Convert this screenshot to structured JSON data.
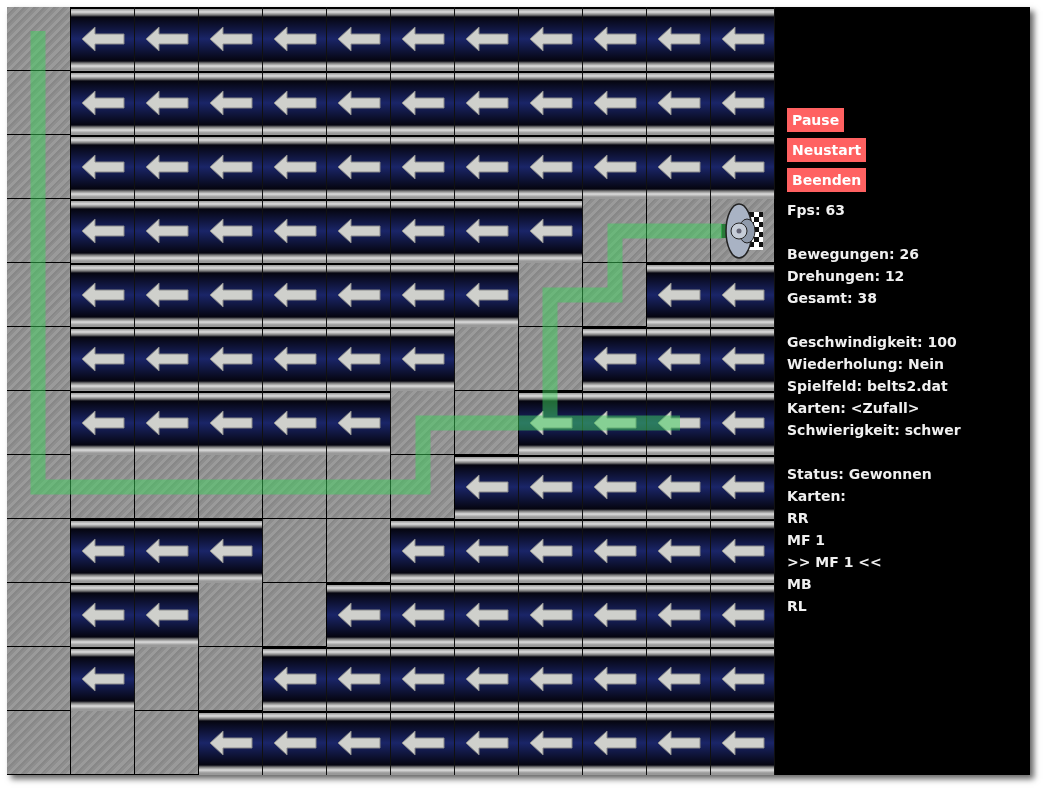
{
  "board": {
    "rows": [
      {
        "cells": [
          {
            "kind": "floor"
          },
          {
            "kind": "belt"
          },
          {
            "kind": "belt"
          },
          {
            "kind": "belt"
          },
          {
            "kind": "belt"
          },
          {
            "kind": "belt"
          },
          {
            "kind": "belt"
          },
          {
            "kind": "belt"
          },
          {
            "kind": "belt"
          },
          {
            "kind": "belt"
          },
          {
            "kind": "belt"
          },
          {
            "kind": "belt"
          }
        ]
      },
      {
        "cells": [
          {
            "kind": "floor"
          },
          {
            "kind": "belt"
          },
          {
            "kind": "belt"
          },
          {
            "kind": "belt"
          },
          {
            "kind": "belt"
          },
          {
            "kind": "belt"
          },
          {
            "kind": "belt"
          },
          {
            "kind": "belt"
          },
          {
            "kind": "belt"
          },
          {
            "kind": "belt"
          },
          {
            "kind": "belt"
          },
          {
            "kind": "belt"
          }
        ]
      },
      {
        "cells": [
          {
            "kind": "floor"
          },
          {
            "kind": "belt"
          },
          {
            "kind": "belt"
          },
          {
            "kind": "belt"
          },
          {
            "kind": "belt"
          },
          {
            "kind": "belt"
          },
          {
            "kind": "belt"
          },
          {
            "kind": "belt"
          },
          {
            "kind": "belt"
          },
          {
            "kind": "belt"
          },
          {
            "kind": "belt"
          },
          {
            "kind": "belt"
          }
        ]
      },
      {
        "cells": [
          {
            "kind": "floor"
          },
          {
            "kind": "belt"
          },
          {
            "kind": "belt"
          },
          {
            "kind": "belt"
          },
          {
            "kind": "belt"
          },
          {
            "kind": "belt"
          },
          {
            "kind": "belt"
          },
          {
            "kind": "belt"
          },
          {
            "kind": "belt"
          },
          {
            "kind": "floor"
          },
          {
            "kind": "floor"
          },
          {
            "kind": "robot"
          }
        ]
      },
      {
        "cells": [
          {
            "kind": "floor"
          },
          {
            "kind": "belt"
          },
          {
            "kind": "belt"
          },
          {
            "kind": "belt"
          },
          {
            "kind": "belt"
          },
          {
            "kind": "belt"
          },
          {
            "kind": "belt"
          },
          {
            "kind": "belt"
          },
          {
            "kind": "floor"
          },
          {
            "kind": "floor"
          },
          {
            "kind": "belt"
          },
          {
            "kind": "belt"
          }
        ]
      },
      {
        "cells": [
          {
            "kind": "floor"
          },
          {
            "kind": "belt"
          },
          {
            "kind": "belt"
          },
          {
            "kind": "belt"
          },
          {
            "kind": "belt"
          },
          {
            "kind": "belt"
          },
          {
            "kind": "belt"
          },
          {
            "kind": "floor"
          },
          {
            "kind": "floor"
          },
          {
            "kind": "belt"
          },
          {
            "kind": "belt"
          },
          {
            "kind": "belt"
          }
        ]
      },
      {
        "cells": [
          {
            "kind": "floor"
          },
          {
            "kind": "belt"
          },
          {
            "kind": "belt"
          },
          {
            "kind": "belt"
          },
          {
            "kind": "belt"
          },
          {
            "kind": "belt"
          },
          {
            "kind": "floor"
          },
          {
            "kind": "floor"
          },
          {
            "kind": "belt"
          },
          {
            "kind": "belt"
          },
          {
            "kind": "belt"
          },
          {
            "kind": "belt"
          }
        ]
      },
      {
        "cells": [
          {
            "kind": "floor"
          },
          {
            "kind": "floor"
          },
          {
            "kind": "floor"
          },
          {
            "kind": "floor"
          },
          {
            "kind": "floor"
          },
          {
            "kind": "floor"
          },
          {
            "kind": "floor"
          },
          {
            "kind": "belt"
          },
          {
            "kind": "belt"
          },
          {
            "kind": "belt"
          },
          {
            "kind": "belt"
          },
          {
            "kind": "belt"
          }
        ]
      },
      {
        "cells": [
          {
            "kind": "floor"
          },
          {
            "kind": "belt"
          },
          {
            "kind": "belt"
          },
          {
            "kind": "belt"
          },
          {
            "kind": "floor"
          },
          {
            "kind": "floor"
          },
          {
            "kind": "belt"
          },
          {
            "kind": "belt"
          },
          {
            "kind": "belt"
          },
          {
            "kind": "belt"
          },
          {
            "kind": "belt"
          },
          {
            "kind": "belt"
          }
        ]
      },
      {
        "cells": [
          {
            "kind": "floor"
          },
          {
            "kind": "belt"
          },
          {
            "kind": "belt"
          },
          {
            "kind": "floor"
          },
          {
            "kind": "floor"
          },
          {
            "kind": "belt"
          },
          {
            "kind": "belt"
          },
          {
            "kind": "belt"
          },
          {
            "kind": "belt"
          },
          {
            "kind": "belt"
          },
          {
            "kind": "belt"
          },
          {
            "kind": "belt"
          }
        ]
      },
      {
        "cells": [
          {
            "kind": "floor"
          },
          {
            "kind": "belt"
          },
          {
            "kind": "floor"
          },
          {
            "kind": "floor"
          },
          {
            "kind": "belt"
          },
          {
            "kind": "belt"
          },
          {
            "kind": "belt"
          },
          {
            "kind": "belt"
          },
          {
            "kind": "belt"
          },
          {
            "kind": "belt"
          },
          {
            "kind": "belt"
          },
          {
            "kind": "belt"
          }
        ]
      },
      {
        "cells": [
          {
            "kind": "floor"
          },
          {
            "kind": "floor"
          },
          {
            "kind": "floor"
          },
          {
            "kind": "belt"
          },
          {
            "kind": "belt"
          },
          {
            "kind": "belt"
          },
          {
            "kind": "belt"
          },
          {
            "kind": "belt"
          },
          {
            "kind": "belt"
          },
          {
            "kind": "belt"
          },
          {
            "kind": "belt"
          },
          {
            "kind": "belt"
          }
        ]
      }
    ]
  },
  "buttons": [
    "Pause",
    "Neustart",
    "Beenden"
  ],
  "info_groups": [
    [
      "Fps: 63"
    ],
    [
      "Bewegungen: 26",
      "Drehungen: 12",
      "Gesamt: 38"
    ],
    [
      "Geschwindigkeit: 100",
      "Wiederholung: Nein",
      "Spielfeld: belts2.dat",
      "Karten: <Zufall>",
      "Schwierigkeit: schwer"
    ],
    [
      "Status: Gewonnen",
      "Karten:",
      "RR",
      "MF 1",
      ">> MF 1 <<",
      "MB",
      "RL"
    ]
  ]
}
